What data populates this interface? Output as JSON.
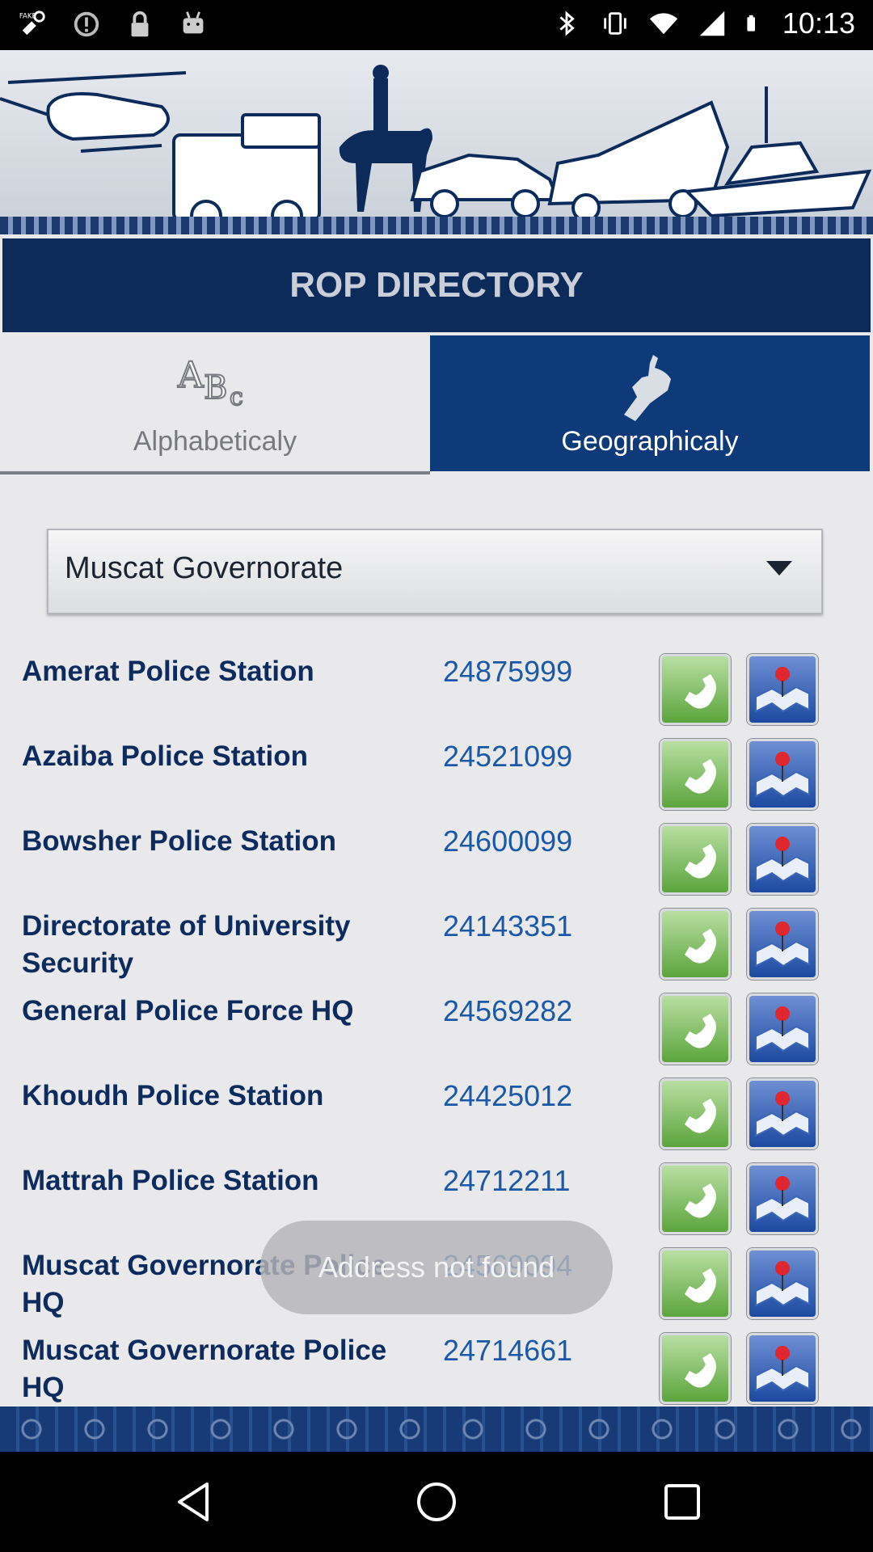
{
  "status_bar": {
    "time": "10:13",
    "left_icons": [
      "fake-gps-icon",
      "circle-alert-icon",
      "lock-icon",
      "android-icon"
    ],
    "right_icons": [
      "bluetooth-icon",
      "vibrate-icon",
      "wifi-icon",
      "signal-icon",
      "battery-icon"
    ]
  },
  "header": {
    "title": "ROP DIRECTORY"
  },
  "tabs": [
    {
      "label": "Alphabeticaly",
      "icon": "abc-icon",
      "active": false
    },
    {
      "label": "Geographicaly",
      "icon": "oman-map-icon",
      "active": true
    }
  ],
  "dropdown": {
    "selected": "Muscat Governorate"
  },
  "stations": [
    {
      "name": "Amerat Police Station",
      "phone": "24875999"
    },
    {
      "name": "Azaiba Police Station",
      "phone": "24521099"
    },
    {
      "name": "Bowsher Police Station",
      "phone": "24600099"
    },
    {
      "name": "Directorate of University Security",
      "phone": "24143351"
    },
    {
      "name": "General Police Force HQ",
      "phone": "24569282"
    },
    {
      "name": "Khoudh Police Station",
      "phone": "24425012"
    },
    {
      "name": "Mattrah Police Station",
      "phone": "24712211"
    },
    {
      "name": "Muscat Governorate Police HQ",
      "phone": "24569094"
    },
    {
      "name": "Muscat Governorate Police HQ",
      "phone": "24714661"
    }
  ],
  "toast": {
    "message": "Address not found"
  },
  "colors": {
    "title_bg": "#0c2b5b",
    "active_tab_bg": "#0e3a79",
    "station_name": "#0d2b5c",
    "phone": "#1a58a8",
    "call_button": "#5ba53c",
    "map_button": "#1d4aa0"
  },
  "nav": [
    "back-icon",
    "home-icon",
    "recents-icon"
  ]
}
